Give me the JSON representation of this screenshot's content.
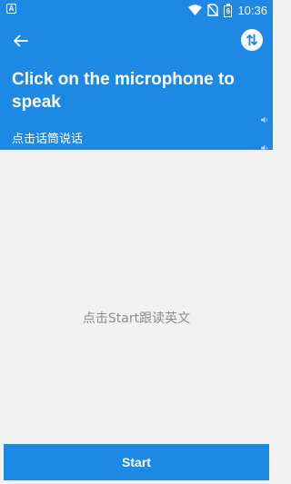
{
  "status_bar": {
    "notification_icon_label": "A",
    "battery_level": "6",
    "time": "10:36"
  },
  "header": {
    "title": "Click on the microphone to speak",
    "subtitle": "点击话筒说话"
  },
  "content": {
    "hint": "点击Start跟读英文"
  },
  "footer": {
    "start_label": "Start"
  },
  "colors": {
    "accent": "#1e88e5",
    "background": "#f2f2f2",
    "hint_text": "#8c8c8c"
  },
  "icons": [
    "back-arrow-icon",
    "swap-vertical-icon",
    "speaker-icon",
    "wifi-icon",
    "no-sim-icon",
    "battery-icon"
  ]
}
